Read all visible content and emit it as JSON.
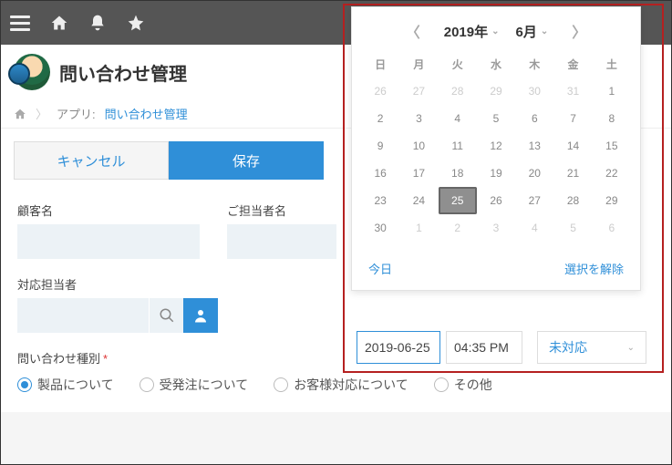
{
  "header": {
    "title": "問い合わせ管理"
  },
  "crumbs": {
    "app_prefix": "アプリ:",
    "app_link": "問い合わせ管理"
  },
  "buttons": {
    "cancel": "キャンセル",
    "save": "保存"
  },
  "labels": {
    "customer": "顧客名",
    "contact": "ご担当者名",
    "assignee": "対応担当者",
    "category": "問い合わせ種別"
  },
  "radios": {
    "product": "製品について",
    "order": "受発注について",
    "support": "お客様対応について",
    "other": "その他"
  },
  "datepicker": {
    "year": "2019年",
    "month": "6月",
    "dow": [
      "日",
      "月",
      "火",
      "水",
      "木",
      "金",
      "土"
    ],
    "prev_out": [
      26,
      27,
      28,
      29,
      30,
      31
    ],
    "days": [
      1,
      2,
      3,
      4,
      5,
      6,
      7,
      8,
      9,
      10,
      11,
      12,
      13,
      14,
      15,
      16,
      17,
      18,
      19,
      20,
      21,
      22,
      23,
      24,
      25,
      26,
      27,
      28,
      29,
      30
    ],
    "next_out": [
      1,
      2,
      3,
      4,
      5,
      6
    ],
    "selected": 25,
    "today": "今日",
    "clear": "選択を解除"
  },
  "datetime": {
    "date": "2019-06-25",
    "time": "04:35 PM"
  },
  "status": {
    "value": "未対応"
  }
}
